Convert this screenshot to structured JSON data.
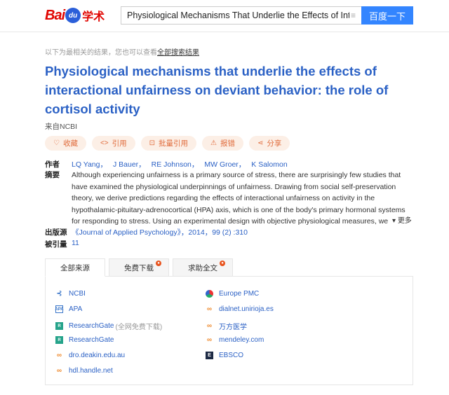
{
  "header": {
    "logo_bai": "Bai",
    "logo_du": "du",
    "logo_xueshu": "学术",
    "search_value": "Physiological Mechanisms That Underlie the Effects of Interactio",
    "search_button": "百度一下"
  },
  "hint": {
    "prefix": "以下为最相关的结果，您也可以查看",
    "link": "全部搜索结果"
  },
  "paper": {
    "title": "Physiological mechanisms that underlie the effects of interactional unfairness on deviant behavior: the role of cortisol activity",
    "source": "来自NCBI"
  },
  "actions": [
    {
      "icon": "heart-icon",
      "glyph": "♡",
      "label": "收藏"
    },
    {
      "icon": "quote-icon",
      "glyph": "<>",
      "label": "引用"
    },
    {
      "icon": "batch-cite-icon",
      "glyph": "⊡",
      "label": "批量引用"
    },
    {
      "icon": "warning-icon",
      "glyph": "⚠",
      "label": "报错"
    },
    {
      "icon": "share-icon",
      "glyph": "⋖",
      "label": "分享"
    }
  ],
  "meta": {
    "authors_label": "作者",
    "authors": [
      "LQ Yang，",
      "J Bauer，",
      "RE Johnson，",
      "MW Groer，",
      "K Salomon"
    ],
    "abstract_label": "摘要",
    "abstract": "Although experiencing unfairness is a primary source of stress, there are surprisingly few studies that have examined the physiological underpinnings of unfairness. Drawing from social self-preservation theory, we derive predictions regarding the effects of interactional unfairness on activity in the hypothalamic-pituitary-adrenocortical (HPA) axis, which is one of the body's primary hormonal systems for responding to stress. Using an experimental design with objective physiological measures, we found support for our hypothesis that interactional unfairness",
    "more": "更多",
    "published_label": "出版源",
    "published": "《Journal of Applied Psychology》，2014，99 (2) :310",
    "cited_label": "被引量",
    "cited": "11"
  },
  "tabs": [
    {
      "label": "全部来源",
      "badge": ""
    },
    {
      "label": "免费下载",
      "badge": "●"
    },
    {
      "label": "求助全文",
      "badge": "●"
    }
  ],
  "sources_left": [
    {
      "icon": "ncbi-icon",
      "glyph": "⊰",
      "name": "NCBI",
      "note": ""
    },
    {
      "icon": "apa-icon",
      "glyph": "APA",
      "name": "APA",
      "note": ""
    },
    {
      "icon": "researchgate-icon",
      "glyph": "R",
      "name": "ResearchGate",
      "note": "(全网免费下载)"
    },
    {
      "icon": "researchgate-icon",
      "glyph": "R",
      "name": "ResearchGate",
      "note": ""
    },
    {
      "icon": "link-icon",
      "glyph": "∞",
      "name": "dro.deakin.edu.au",
      "note": ""
    },
    {
      "icon": "link-icon",
      "glyph": "∞",
      "name": "hdl.handle.net",
      "note": ""
    }
  ],
  "sources_right": [
    {
      "icon": "europe-pmc-icon",
      "glyph": "",
      "name": "Europe PMC"
    },
    {
      "icon": "link-icon",
      "glyph": "∞",
      "name": "dialnet.unirioja.es"
    },
    {
      "icon": "link-icon",
      "glyph": "∞",
      "name": "万方医学"
    },
    {
      "icon": "link-icon",
      "glyph": "∞",
      "name": "mendeley.com"
    },
    {
      "icon": "ebsco-icon",
      "glyph": "E",
      "name": "EBSCO"
    }
  ],
  "colors": {
    "accent": "#2b61c5",
    "button": "#3385ff",
    "action_bg": "#fcefe6",
    "action_fg": "#e06c3c"
  }
}
